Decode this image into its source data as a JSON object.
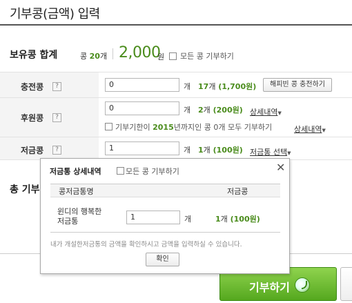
{
  "page": {
    "title": "기부콩(금액) 입력"
  },
  "balance": {
    "label": "보유콩 합계",
    "kong_prefix": "콩",
    "kong_count": "20",
    "kong_suffix": "개",
    "amount": "2,000",
    "unit": "원",
    "donate_all_label": "모든 콩 기부하기"
  },
  "rows": {
    "charge": {
      "label": "충전콩",
      "help": "?",
      "value": "0",
      "unit": "개",
      "count": "17",
      "count_unit": "개",
      "amount": "(1,700원)",
      "button": "해피빈 콩 충전하기"
    },
    "sponsor": {
      "label": "후원콩",
      "help": "?",
      "value": "0",
      "unit": "개",
      "count": "2",
      "count_unit": "개",
      "amount": "(200원)",
      "details_link": "상세내역",
      "expire_prefix": "기부기한이",
      "expire_year": "2015",
      "expire_suffix": "년까지인 콩",
      "expire_count": "0",
      "expire_tail": "개 모두 기부하기",
      "expire_details_link": "상세내역"
    },
    "piggy": {
      "label": "저금콩",
      "help": "?",
      "value": "1",
      "unit": "개",
      "count": "1",
      "count_unit": "개",
      "amount": "(100원)",
      "select_link": "저금통 선택"
    }
  },
  "total": {
    "label": "총 기부"
  },
  "actions": {
    "donate": "기부하기"
  },
  "popup": {
    "title": "저금통 상세내역",
    "donate_all_label": "모든 콩 기부하기",
    "close": "✕",
    "col_name": "콩저금통명",
    "col_amount": "저금콩",
    "row_name_line1": "윈디의 행복한",
    "row_name_line2": "저금통",
    "row_value": "1",
    "row_unit": "개",
    "row_count": "1",
    "row_count_unit": "개",
    "row_amount": "(100원)",
    "note": "내가 개설한저금통의 금액을 확인하시고 금액을 입력하실 수 있습니다.",
    "ok": "확인"
  }
}
